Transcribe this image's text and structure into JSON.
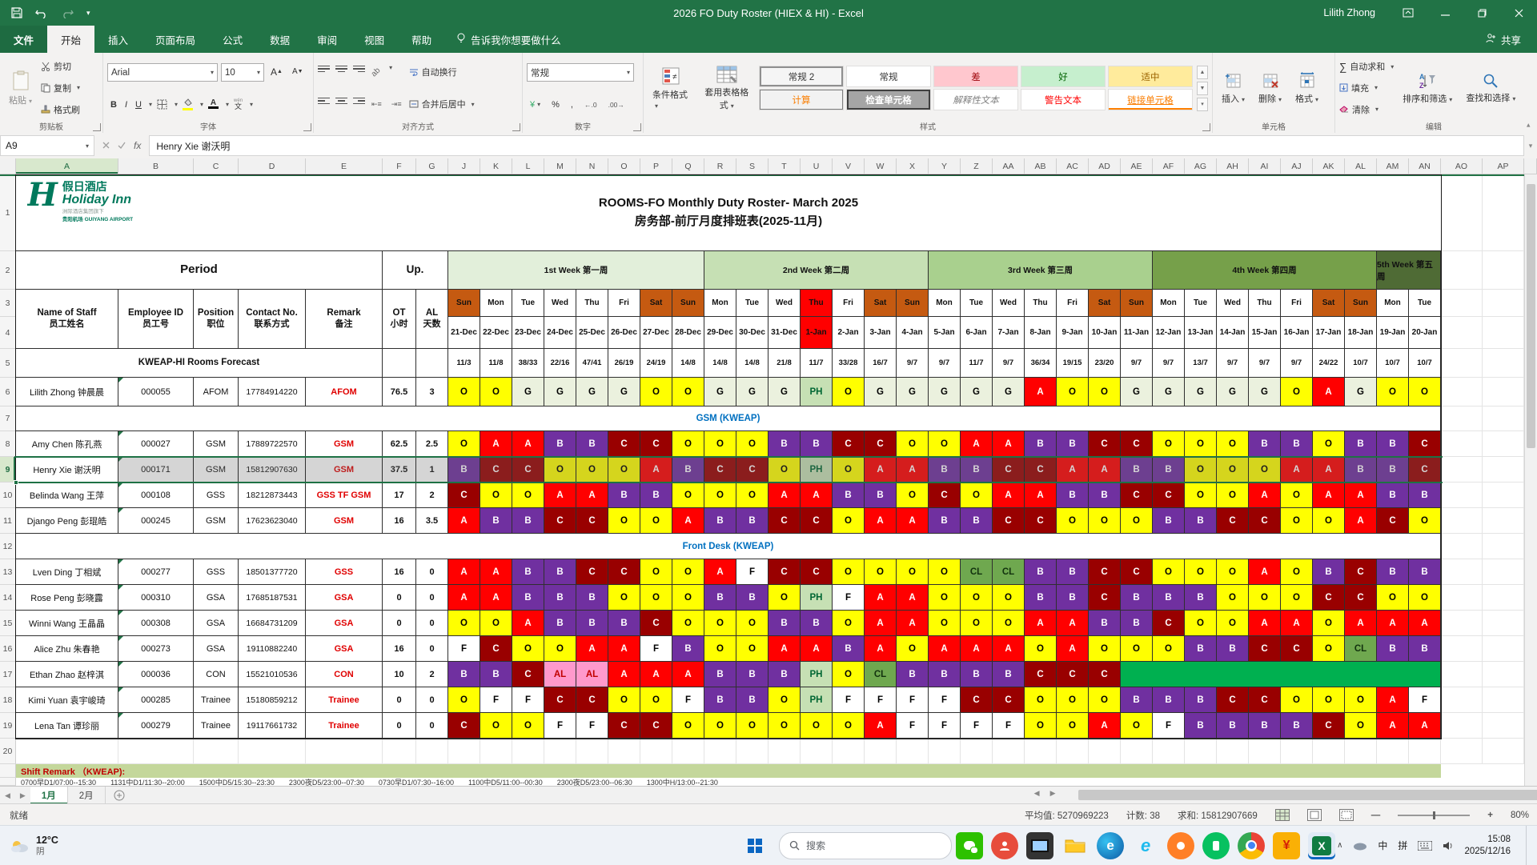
{
  "window": {
    "title": "2026 FO Duty Roster (HIEX & HI)  -  Excel",
    "user": "Lilith Zhong"
  },
  "menu": {
    "tabs": [
      "文件",
      "开始",
      "插入",
      "页面布局",
      "公式",
      "数据",
      "审阅",
      "视图",
      "帮助"
    ],
    "active": "开始",
    "tellme": "告诉我你想要做什么",
    "share": "共享"
  },
  "ribbon": {
    "clipboard": {
      "label": "剪贴板",
      "paste": "粘贴",
      "cut": "剪切",
      "copy": "复制",
      "painter": "格式刷"
    },
    "font": {
      "label": "字体",
      "name": "Arial",
      "size": "10",
      "bold": "B",
      "italic": "I",
      "underline": "U",
      "phonetic": "文"
    },
    "align": {
      "label": "对齐方式",
      "wrap": "自动换行",
      "merge": "合并后居中"
    },
    "number": {
      "label": "数字",
      "format": "常规",
      "currency": "¥",
      "percent": "%",
      "comma": ",",
      "dec_add": "←.0",
      "dec_del": ".00→"
    },
    "styles": {
      "label": "样式",
      "conditional": "条件格式",
      "table": "套用表格格式",
      "gallery_row1": [
        {
          "label": "常规 2"
        },
        {
          "label": "常规"
        },
        {
          "label": "差"
        },
        {
          "label": "好"
        },
        {
          "label": "适中"
        }
      ],
      "gallery_row2": [
        {
          "label": "计算"
        },
        {
          "label": "检查单元格"
        },
        {
          "label": "解释性文本"
        },
        {
          "label": "警告文本"
        },
        {
          "label": "链接单元格"
        }
      ]
    },
    "cells": {
      "label": "单元格",
      "insert": "插入",
      "delete": "删除",
      "format": "格式"
    },
    "editing": {
      "label": "编辑",
      "autosum_icon": "∑",
      "autosum": "自动求和",
      "fill": "填充",
      "clear": "清除",
      "sort": "排序和筛选",
      "find": "查找和选择"
    }
  },
  "formula_bar": {
    "name_box": "A9",
    "fx": "fx",
    "value": "Henry Xie 谢沃明"
  },
  "grid": {
    "col_letters": [
      "A",
      "B",
      "C",
      "D",
      "E",
      "F",
      "G",
      "J",
      "K",
      "L",
      "M",
      "N",
      "O",
      "P",
      "Q",
      "R",
      "S",
      "T",
      "U",
      "V",
      "W",
      "X",
      "Y",
      "Z",
      "AA",
      "AB",
      "AC",
      "AD",
      "AE",
      "AF",
      "AG",
      "AH",
      "AI",
      "AJ",
      "AK",
      "AL",
      "AM",
      "AN",
      "AO",
      "AP"
    ],
    "selected_cell": {
      "col": "A",
      "row": 9
    },
    "logo": {
      "cn": "假日酒店",
      "en": "Holiday Inn",
      "sub1": "洲际酒店集团旗下",
      "sub2": "贵阳机场",
      "sub3": "GUIYANG AIRPORT"
    },
    "title_en": "ROOMS-FO Monthly Duty Roster- March 2025",
    "title_cn": "房务部-前厅月度排班表(2025-11月)",
    "period": "Period",
    "up": "Up.",
    "headers": {
      "name": "Name of Staff",
      "name_cn": "员工姓名",
      "id": "Employee ID",
      "id_cn": "员工号",
      "pos": "Position",
      "pos_cn": "职位",
      "contact": "Contact No.",
      "contact_cn": "联系方式",
      "remark": "Remark",
      "remark_cn": "备注",
      "ot": "OT",
      "ot_cn": "小时",
      "al": "AL",
      "al_cn": "天数"
    },
    "forecast_label": "KWEAP-HI Rooms Forecast",
    "weeks": [
      {
        "label": "1st Week 第一周",
        "span": 8,
        "color": "#E2EFDA"
      },
      {
        "label": "2nd Week 第二周",
        "span": 7,
        "color": "#C6E0B4"
      },
      {
        "label": "3rd Week 第三周",
        "span": 7,
        "color": "#A9D08E"
      },
      {
        "label": "4th Week 第四周",
        "span": 7,
        "color": "#76A04A"
      },
      {
        "label": "5th Week 第五周",
        "span": 2,
        "color": "#4F6B35"
      }
    ],
    "days": [
      "Sun",
      "Mon",
      "Tue",
      "Wed",
      "Thu",
      "Fri",
      "Sat",
      "Sun",
      "Mon",
      "Tue",
      "Wed",
      "Thu",
      "Fri",
      "Sat",
      "Sun",
      "Mon",
      "Tue",
      "Wed",
      "Thu",
      "Fri",
      "Sat",
      "Sun",
      "Mon",
      "Tue",
      "Wed",
      "Thu",
      "Fri",
      "Sat",
      "Sun",
      "Mon",
      "Tue"
    ],
    "weekend_idx": [
      0,
      6,
      7,
      13,
      14,
      20,
      21,
      27,
      28
    ],
    "holiday_idx": [
      11
    ],
    "dates": [
      "21-Dec",
      "22-Dec",
      "23-Dec",
      "24-Dec",
      "25-Dec",
      "26-Dec",
      "27-Dec",
      "28-Dec",
      "29-Dec",
      "30-Dec",
      "31-Dec",
      "1-Jan",
      "2-Jan",
      "3-Jan",
      "4-Jan",
      "5-Jan",
      "6-Jan",
      "7-Jan",
      "8-Jan",
      "9-Jan",
      "10-Jan",
      "11-Jan",
      "12-Jan",
      "13-Jan",
      "14-Jan",
      "15-Jan",
      "16-Jan",
      "17-Jan",
      "18-Jan",
      "19-Jan",
      "20-Jan"
    ],
    "forecast": [
      "11/3",
      "11/8",
      "38/33",
      "22/16",
      "47/41",
      "26/19",
      "24/19",
      "14/8",
      "14/8",
      "14/8",
      "21/8",
      "11/7",
      "33/28",
      "16/7",
      "9/7",
      "9/7",
      "11/7",
      "9/7",
      "36/34",
      "19/15",
      "23/20",
      "9/7",
      "9/7",
      "13/7",
      "9/7",
      "9/7",
      "9/7",
      "24/22",
      "10/7",
      "10/7",
      "10/7"
    ],
    "section_gsm": "GSM (KWEAP)",
    "section_fd": "Front Desk (KWEAP)",
    "staff": [
      {
        "name": "Lilith Zhong 钟晨晨",
        "id": "000055",
        "pos": "AFOM",
        "contact": "17784914220",
        "remark": "AFOM",
        "ot": "76.5",
        "al": "3",
        "shifts": [
          "O",
          "O",
          "G",
          "G",
          "G",
          "G",
          "O",
          "O",
          "G",
          "G",
          "G",
          "PH",
          "O",
          "G",
          "G",
          "G",
          "G",
          "G",
          "A",
          "O",
          "O",
          "G",
          "G",
          "G",
          "G",
          "G",
          "O",
          "A",
          "G",
          "O",
          "O"
        ]
      },
      {
        "name": "Amy Chen 陈孔燕",
        "id": "000027",
        "pos": "GSM",
        "contact": "17889722570",
        "remark": "GSM",
        "ot": "62.5",
        "al": "2.5",
        "shifts": [
          "O",
          "A",
          "A",
          "B",
          "B",
          "C",
          "C",
          "O",
          "O",
          "O",
          "B",
          "B",
          "C",
          "C",
          "O",
          "O",
          "A",
          "A",
          "B",
          "B",
          "C",
          "C",
          "O",
          "O",
          "O",
          "B",
          "B",
          "O",
          "B",
          "B",
          "C"
        ]
      },
      {
        "name": "Henry Xie 谢沃明",
        "id": "000171",
        "pos": "GSM",
        "contact": "15812907630",
        "remark": "GSM",
        "ot": "37.5",
        "al": "1",
        "selected": true,
        "shifts": [
          "B",
          "C",
          "C",
          "O",
          "O",
          "O",
          "A",
          "B",
          "C",
          "C",
          "O",
          "PH",
          "O",
          "A",
          "A",
          "B",
          "B",
          "C",
          "C",
          "A",
          "A",
          "B",
          "B",
          "O",
          "O",
          "O",
          "A",
          "A",
          "B",
          "B",
          "C"
        ]
      },
      {
        "name": "Belinda Wang 王萍",
        "id": "000108",
        "pos": "GSS",
        "contact": "18212873443",
        "remark": "GSS TF GSM",
        "ot": "17",
        "al": "2",
        "shifts": [
          "C",
          "O",
          "O",
          "A",
          "A",
          "B",
          "B",
          "O",
          "O",
          "O",
          "A",
          "A",
          "B",
          "B",
          "O",
          "C",
          "O",
          "A",
          "A",
          "B",
          "B",
          "C",
          "C",
          "O",
          "O",
          "A",
          "O",
          "A",
          "A",
          "B",
          "B"
        ]
      },
      {
        "name": "Django Peng 彭琨皓",
        "id": "000245",
        "pos": "GSM",
        "contact": "17623623040",
        "remark": "GSM",
        "ot": "16",
        "al": "3.5",
        "shifts": [
          "A",
          "B",
          "B",
          "C",
          "C",
          "O",
          "O",
          "A",
          "B",
          "B",
          "C",
          "C",
          "O",
          "A",
          "A",
          "B",
          "B",
          "C",
          "C",
          "O",
          "O",
          "O",
          "B",
          "B",
          "C",
          "C",
          "O",
          "O",
          "A",
          "C",
          "O"
        ]
      },
      {
        "name": "Lven Ding 丁相斌",
        "id": "000277",
        "pos": "GSS",
        "contact": "18501377720",
        "remark": "GSS",
        "ot": "16",
        "al": "0",
        "shifts": [
          "A",
          "A",
          "B",
          "B",
          "C",
          "C",
          "O",
          "O",
          "A",
          "F",
          "C",
          "C",
          "O",
          "O",
          "O",
          "O",
          "CL",
          "CL",
          "B",
          "B",
          "C",
          "C",
          "O",
          "O",
          "O",
          "A",
          "O",
          "B",
          "C",
          "B",
          "B"
        ]
      },
      {
        "name": "Rose Peng 彭晓露",
        "id": "000310",
        "pos": "GSA",
        "contact": "17685187531",
        "remark": "GSA",
        "ot": "0",
        "al": "0",
        "shifts": [
          "A",
          "A",
          "B",
          "B",
          "B",
          "O",
          "O",
          "O",
          "B",
          "B",
          "O",
          "PH",
          "F",
          "A",
          "A",
          "O",
          "O",
          "O",
          "B",
          "B",
          "C",
          "B",
          "B",
          "B",
          "O",
          "O",
          "O",
          "C",
          "C",
          "O",
          "O"
        ]
      },
      {
        "name": "Winni Wang 王晶晶",
        "id": "000308",
        "pos": "GSA",
        "contact": "16684731209",
        "remark": "GSA",
        "ot": "0",
        "al": "0",
        "shifts": [
          "O",
          "O",
          "A",
          "B",
          "B",
          "B",
          "C",
          "O",
          "O",
          "O",
          "B",
          "B",
          "O",
          "A",
          "A",
          "O",
          "O",
          "O",
          "A",
          "A",
          "B",
          "B",
          "C",
          "O",
          "O",
          "A",
          "A",
          "O",
          "A",
          "A",
          "A"
        ]
      },
      {
        "name": "Alice Zhu 朱春艳",
        "id": "000273",
        "pos": "GSA",
        "contact": "19110882240",
        "remark": "GSA",
        "ot": "16",
        "al": "0",
        "shifts": [
          "F",
          "C",
          "O",
          "O",
          "A",
          "A",
          "F",
          "B",
          "O",
          "O",
          "A",
          "A",
          "B",
          "A",
          "O",
          "A",
          "A",
          "A",
          "O",
          "A",
          "O",
          "O",
          "O",
          "B",
          "B",
          "C",
          "C",
          "O",
          "CL",
          "B",
          "B"
        ]
      },
      {
        "name": "Ethan Zhao 赵梓淇",
        "id": "000036",
        "pos": "CON",
        "contact": "15521010536",
        "remark": "CON",
        "ot": "10",
        "al": "2",
        "green_from": 21,
        "shifts": [
          "B",
          "B",
          "C",
          "AL",
          "AL",
          "A",
          "A",
          "A",
          "B",
          "B",
          "B",
          "PH",
          "O",
          "CL",
          "B",
          "B",
          "B",
          "B",
          "C",
          "C",
          "C"
        ]
      },
      {
        "name": "Kimi Yuan 袁宇峻琦",
        "id": "000285",
        "pos": "Trainee",
        "contact": "15180859212",
        "remark": "Trainee",
        "ot": "0",
        "al": "0",
        "shifts": [
          "O",
          "F",
          "F",
          "C",
          "C",
          "O",
          "O",
          "F",
          "B",
          "B",
          "O",
          "PH",
          "F",
          "F",
          "F",
          "F",
          "C",
          "C",
          "O",
          "O",
          "O",
          "B",
          "B",
          "B",
          "C",
          "C",
          "O",
          "O",
          "O",
          "A",
          "F"
        ]
      },
      {
        "name": "Lena Tan 谭珍丽",
        "id": "000279",
        "pos": "Trainee",
        "contact": "19117661732",
        "remark": "Trainee",
        "ot": "0",
        "al": "0",
        "shifts": [
          "C",
          "O",
          "O",
          "F",
          "F",
          "C",
          "C",
          "O",
          "O",
          "O",
          "O",
          "O",
          "O",
          "A",
          "F",
          "F",
          "F",
          "F",
          "O",
          "O",
          "A",
          "O",
          "F",
          "B",
          "B",
          "B",
          "B",
          "C",
          "O",
          "A",
          "A"
        ]
      }
    ],
    "remark_title": "Shift Remark （KWEAP):",
    "remark_detail": "0700早D1/07:00--15:30　　1131中D1/11:30--20:00　　1500中D5/15:30--23:30　　2300夜D5/23:00--07:30　　0730早D1/07:30--16:00　　1100中D5/11:00--00:30　　2300夜D5/23:00--06:30　　1300中H/13:00--21:30"
  },
  "sheet_tabs": {
    "active": "1月",
    "second": "2月"
  },
  "status": {
    "ready": "就绪",
    "average": "平均值: 5270969223",
    "count": "计数: 38",
    "sum": "求和: 15812907669",
    "zoom": "80%"
  },
  "taskbar": {
    "temp": "12°C",
    "weather": "阴",
    "search": "搜索",
    "ime1": "中",
    "ime2": "拼",
    "time": "15:08",
    "date": "2025/12/16"
  }
}
